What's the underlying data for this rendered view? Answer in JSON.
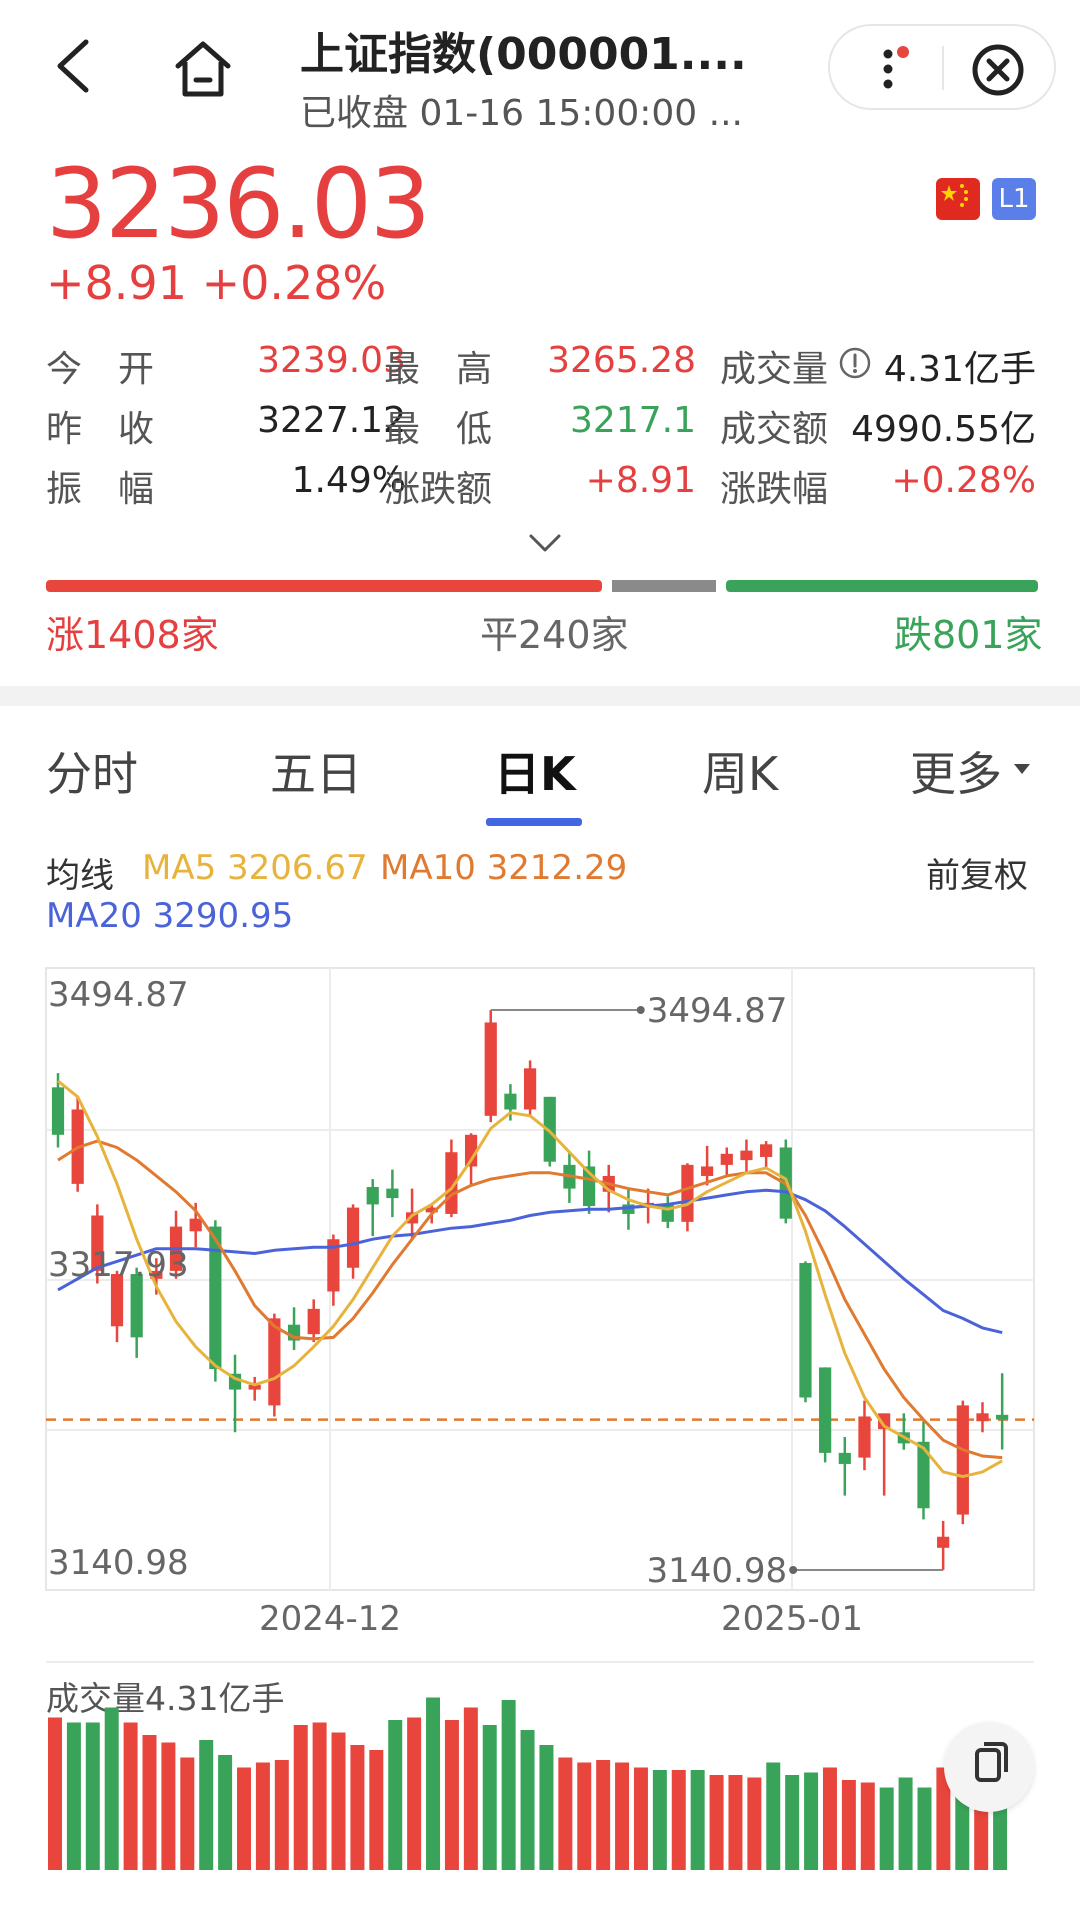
{
  "header": {
    "title": "上证指数(000001....",
    "subtitle": "已收盘 01-16 15:00:00 ..."
  },
  "quote": {
    "price": "3236.03",
    "change": "+8.91  +0.28%",
    "badge_l1": "L1"
  },
  "stats": [
    [
      {
        "label": "今　开",
        "value": "3239.03",
        "tone": "r"
      },
      {
        "label": "最　高",
        "value": "3265.28",
        "tone": "r"
      },
      {
        "label": "成交量",
        "value": "4.31亿手",
        "tone": "n",
        "info": true
      }
    ],
    [
      {
        "label": "昨　收",
        "value": "3227.12",
        "tone": "n"
      },
      {
        "label": "最　低",
        "value": "3217.1",
        "tone": "g"
      },
      {
        "label": "成交额",
        "value": "4990.55亿",
        "tone": "n"
      }
    ],
    [
      {
        "label": "振　幅",
        "value": "1.49%",
        "tone": "n"
      },
      {
        "label": "涨跌额",
        "value": "+8.91",
        "tone": "r"
      },
      {
        "label": "涨跌幅",
        "value": "+0.28%",
        "tone": "r"
      }
    ]
  ],
  "breadth": {
    "up": "涨1408家",
    "flat": "平240家",
    "down": "跌801家"
  },
  "tabs": [
    {
      "label": "分时",
      "active": false
    },
    {
      "label": "五日",
      "active": false
    },
    {
      "label": "日K",
      "active": true
    },
    {
      "label": "周K",
      "active": false
    },
    {
      "label": "更多",
      "active": false
    }
  ],
  "ma": {
    "title": "均线",
    "ma5": "MA5 3206.67",
    "ma10": "MA10 3212.29",
    "ma20": "MA20 3290.95",
    "adjust": "前复权"
  },
  "colors": {
    "up": "#e8453c",
    "down": "#3aa35a",
    "ma5": "#e8b33c",
    "ma10": "#e07a30",
    "ma20": "#4a63d8",
    "accent": "#4366e3"
  },
  "volume_label": "成交量4.31亿手",
  "chart_data": {
    "type": "candlestick",
    "y_labels": [
      "3494.87",
      "3317.93",
      "3140.98"
    ],
    "ylim": [
      3140.98,
      3494.87
    ],
    "x_labels": [
      "2024-12",
      "2025-01"
    ],
    "max_annotation": "3494.87",
    "min_annotation": "3140.98",
    "close_ref": 3236.03,
    "candles": [
      {
        "o": 3446,
        "h": 3455,
        "l": 3408,
        "c": 3416
      },
      {
        "o": 3385,
        "h": 3440,
        "l": 3380,
        "c": 3432
      },
      {
        "o": 3330,
        "h": 3372,
        "l": 3322,
        "c": 3365
      },
      {
        "o": 3295,
        "h": 3330,
        "l": 3285,
        "c": 3328
      },
      {
        "o": 3328,
        "h": 3332,
        "l": 3275,
        "c": 3288
      },
      {
        "o": 3325,
        "h": 3338,
        "l": 3315,
        "c": 3330
      },
      {
        "o": 3330,
        "h": 3368,
        "l": 3325,
        "c": 3358
      },
      {
        "o": 3355,
        "h": 3373,
        "l": 3345,
        "c": 3363
      },
      {
        "o": 3358,
        "h": 3362,
        "l": 3260,
        "c": 3268
      },
      {
        "o": 3265,
        "h": 3277,
        "l": 3228,
        "c": 3255
      },
      {
        "o": 3255,
        "h": 3263,
        "l": 3248,
        "c": 3258
      },
      {
        "o": 3245,
        "h": 3303,
        "l": 3238,
        "c": 3300
      },
      {
        "o": 3296,
        "h": 3307,
        "l": 3280,
        "c": 3286
      },
      {
        "o": 3290,
        "h": 3312,
        "l": 3285,
        "c": 3306
      },
      {
        "o": 3317,
        "h": 3353,
        "l": 3308,
        "c": 3350
      },
      {
        "o": 3332,
        "h": 3372,
        "l": 3325,
        "c": 3370
      },
      {
        "o": 3383,
        "h": 3388,
        "l": 3352,
        "c": 3372
      },
      {
        "o": 3382,
        "h": 3394,
        "l": 3364,
        "c": 3376
      },
      {
        "o": 3360,
        "h": 3382,
        "l": 3350,
        "c": 3367
      },
      {
        "o": 3367,
        "h": 3372,
        "l": 3360,
        "c": 3370
      },
      {
        "o": 3366,
        "h": 3413,
        "l": 3364,
        "c": 3405
      },
      {
        "o": 3396,
        "h": 3417,
        "l": 3384,
        "c": 3416
      },
      {
        "o": 3428,
        "h": 3494.87,
        "l": 3424,
        "c": 3487
      },
      {
        "o": 3442,
        "h": 3448,
        "l": 3425,
        "c": 3432
      },
      {
        "o": 3432,
        "h": 3463,
        "l": 3428,
        "c": 3458
      },
      {
        "o": 3440,
        "h": 3440,
        "l": 3396,
        "c": 3399
      },
      {
        "o": 3397,
        "h": 3405,
        "l": 3373,
        "c": 3382
      },
      {
        "o": 3396,
        "h": 3406,
        "l": 3366,
        "c": 3371
      },
      {
        "o": 3380,
        "h": 3397,
        "l": 3367,
        "c": 3390
      },
      {
        "o": 3372,
        "h": 3382,
        "l": 3356,
        "c": 3366
      },
      {
        "o": 3370,
        "h": 3382,
        "l": 3360,
        "c": 3373
      },
      {
        "o": 3372,
        "h": 3377,
        "l": 3357,
        "c": 3361
      },
      {
        "o": 3361,
        "h": 3398,
        "l": 3355,
        "c": 3397
      },
      {
        "o": 3390,
        "h": 3409,
        "l": 3384,
        "c": 3396
      },
      {
        "o": 3397,
        "h": 3408,
        "l": 3390,
        "c": 3404
      },
      {
        "o": 3400,
        "h": 3413,
        "l": 3392,
        "c": 3406
      },
      {
        "o": 3402,
        "h": 3412,
        "l": 3395,
        "c": 3410
      },
      {
        "o": 3408,
        "h": 3413,
        "l": 3360,
        "c": 3363
      },
      {
        "o": 3335,
        "h": 3336,
        "l": 3247,
        "c": 3250
      },
      {
        "o": 3269,
        "h": 3269,
        "l": 3209,
        "c": 3215
      },
      {
        "o": 3215,
        "h": 3225,
        "l": 3188,
        "c": 3208
      },
      {
        "o": 3212,
        "h": 3248,
        "l": 3204,
        "c": 3238
      },
      {
        "o": 3230,
        "h": 3238,
        "l": 3188,
        "c": 3240
      },
      {
        "o": 3228,
        "h": 3240,
        "l": 3217,
        "c": 3221
      },
      {
        "o": 3222,
        "h": 3235,
        "l": 3173,
        "c": 3180
      },
      {
        "o": 3155,
        "h": 3172,
        "l": 3140.98,
        "c": 3162
      },
      {
        "o": 3176,
        "h": 3248,
        "l": 3170,
        "c": 3245
      },
      {
        "o": 3235,
        "h": 3247,
        "l": 3228,
        "c": 3240
      },
      {
        "o": 3239.03,
        "h": 3265.28,
        "l": 3217.1,
        "c": 3236.03
      }
    ],
    "ma5": [
      3450,
      3440,
      3415,
      3385,
      3350,
      3320,
      3298,
      3282,
      3270,
      3262,
      3258,
      3262,
      3270,
      3282,
      3295,
      3312,
      3332,
      3352,
      3365,
      3372,
      3382,
      3400,
      3420,
      3430,
      3428,
      3418,
      3405,
      3392,
      3381,
      3375,
      3371,
      3369,
      3372,
      3380,
      3386,
      3392,
      3395,
      3388,
      3355,
      3315,
      3278,
      3250,
      3232,
      3225,
      3218,
      3203,
      3200,
      3203,
      3210
    ],
    "ma10": [
      3400,
      3408,
      3412,
      3408,
      3400,
      3390,
      3380,
      3368,
      3350,
      3330,
      3308,
      3295,
      3288,
      3287,
      3288,
      3300,
      3316,
      3334,
      3350,
      3366,
      3378,
      3384,
      3388,
      3390,
      3392,
      3392,
      3390,
      3388,
      3385,
      3382,
      3380,
      3378,
      3382,
      3386,
      3390,
      3392,
      3392,
      3385,
      3365,
      3340,
      3312,
      3290,
      3268,
      3250,
      3236,
      3223,
      3217,
      3213,
      3212
    ],
    "ma20": [
      3318,
      3325,
      3332,
      3336,
      3340,
      3344,
      3344,
      3344,
      3343,
      3342,
      3341,
      3343,
      3344,
      3345,
      3345,
      3347,
      3350,
      3352,
      3353,
      3355,
      3357,
      3358,
      3360,
      3362,
      3365,
      3367,
      3368,
      3369,
      3369,
      3370,
      3371,
      3372,
      3374,
      3376,
      3378,
      3380,
      3381,
      3380,
      3375,
      3368,
      3358,
      3347,
      3336,
      3325,
      3315,
      3305,
      3300,
      3294,
      3291
    ],
    "volume": [
      6.1,
      5.9,
      5.9,
      6.5,
      5.9,
      5.4,
      5.1,
      4.5,
      5.2,
      4.6,
      4.1,
      4.3,
      4.4,
      5.8,
      5.9,
      5.5,
      5.0,
      4.8,
      6.0,
      6.1,
      6.9,
      6.0,
      6.5,
      5.8,
      6.8,
      5.6,
      5.0,
      4.5,
      4.3,
      4.4,
      4.3,
      4.1,
      4.0,
      4.0,
      4.0,
      3.8,
      3.8,
      3.7,
      4.3,
      3.8,
      3.9,
      4.1,
      3.6,
      3.5,
      3.3,
      3.7,
      3.3,
      4.1,
      3.9,
      3.7,
      4.3
    ],
    "volume_up": [
      true,
      false,
      false,
      false,
      true,
      true,
      true,
      true,
      false,
      false,
      true,
      true,
      true,
      true,
      true,
      true,
      true,
      true,
      false,
      true,
      false,
      true,
      true,
      false,
      false,
      false,
      false,
      true,
      true,
      true,
      true,
      true,
      false,
      true,
      false,
      true,
      true,
      true,
      false,
      false,
      false,
      true,
      true,
      true,
      false,
      false,
      false,
      true,
      false,
      true,
      false
    ]
  }
}
